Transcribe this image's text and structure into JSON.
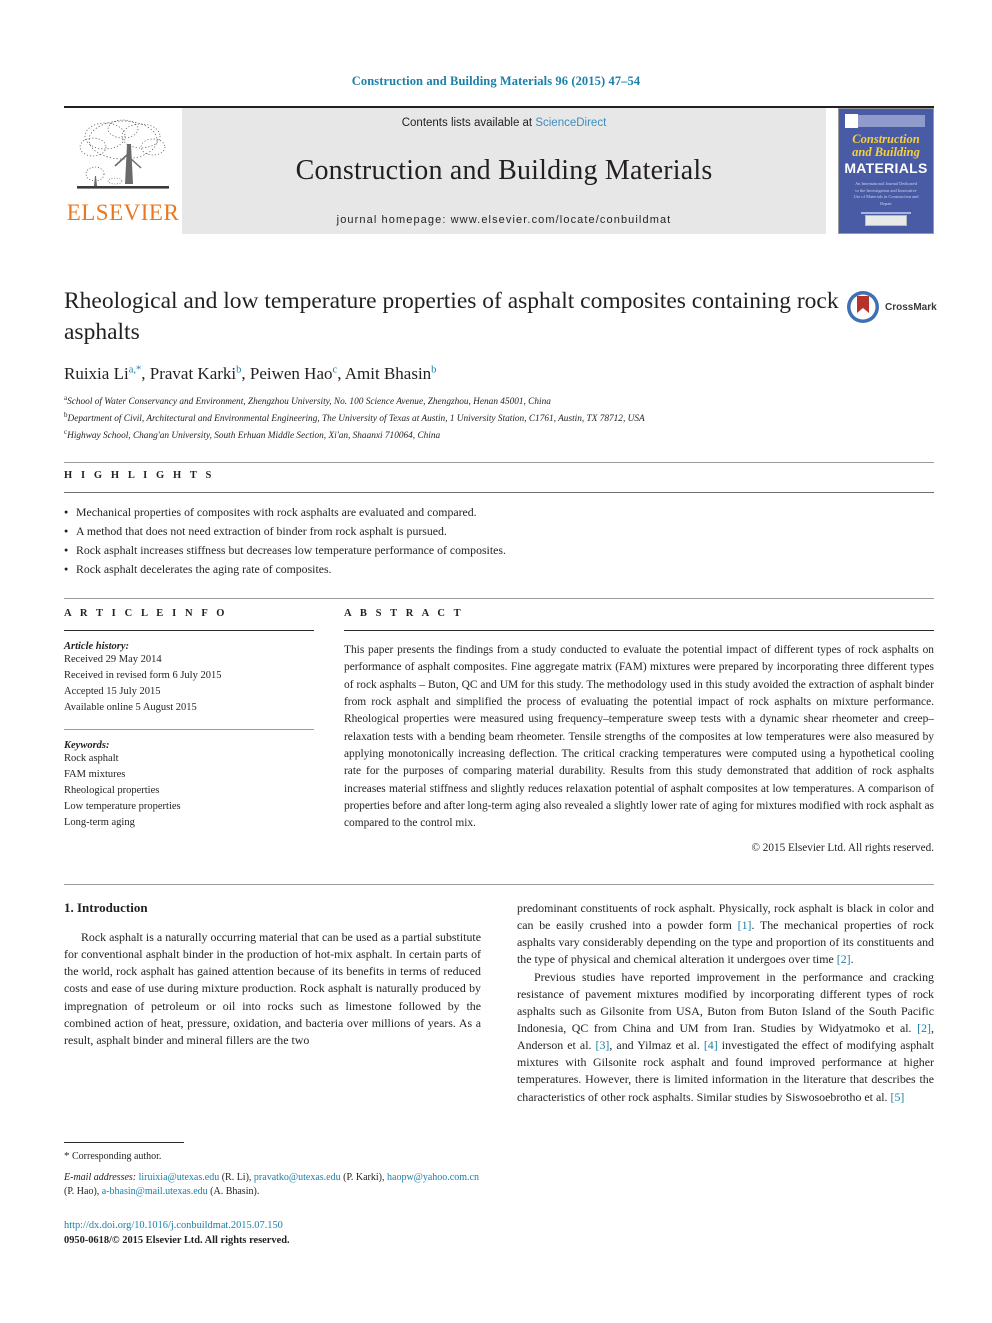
{
  "running_head": "Construction and Building Materials 96 (2015) 47–54",
  "masthead": {
    "publisher_name": "ELSEVIER",
    "contents_prefix": "Contents lists available at ",
    "contents_link": "ScienceDirect",
    "journal_name": "Construction and Building Materials",
    "homepage": "journal homepage: www.elsevier.com/locate/conbuildmat",
    "cover": {
      "line1": "Construction",
      "line2": "and Building",
      "line3": "MATERIALS",
      "blurb": "An International Journal Dedicated to the Investigation and Innovative Use of Materials in Construction and Repair"
    }
  },
  "crossmark": {
    "label": "CrossMark"
  },
  "article": {
    "title": "Rheological and low temperature properties of asphalt composites containing rock asphalts",
    "authors": [
      {
        "name": "Ruixia Li",
        "marks": "a,*"
      },
      {
        "name": "Pravat Karki",
        "marks": "b"
      },
      {
        "name": "Peiwen Hao",
        "marks": "c"
      },
      {
        "name": "Amit Bhasin",
        "marks": "b"
      }
    ],
    "affiliations": [
      {
        "mark": "a",
        "text": "School of Water Conservancy and Environment, Zhengzhou University, No. 100 Science Avenue, Zhengzhou, Henan 45001, China"
      },
      {
        "mark": "b",
        "text": "Department of Civil, Architectural and Environmental Engineering, The University of Texas at Austin, 1 University Station, C1761, Austin, TX 78712, USA"
      },
      {
        "mark": "c",
        "text": "Highway School, Chang'an University, South Erhuan Middle Section, Xi'an, Shaanxi 710064, China"
      }
    ]
  },
  "highlights": {
    "heading": "H I G H L I G H T S",
    "items": [
      "Mechanical properties of composites with rock asphalts are evaluated and compared.",
      "A method that does not need extraction of binder from rock asphalt is pursued.",
      "Rock asphalt increases stiffness but decreases low temperature performance of composites.",
      "Rock asphalt decelerates the aging rate of composites."
    ]
  },
  "article_info": {
    "heading": "A R T I C L E    I N F O",
    "history_label": "Article history:",
    "history": [
      "Received 29 May 2014",
      "Received in revised form 6 July 2015",
      "Accepted 15 July 2015",
      "Available online 5 August 2015"
    ],
    "keywords_label": "Keywords:",
    "keywords": [
      "Rock asphalt",
      "FAM mixtures",
      "Rheological properties",
      "Low temperature properties",
      "Long-term aging"
    ]
  },
  "abstract": {
    "heading": "A B S T R A C T",
    "text": "This paper presents the findings from a study conducted to evaluate the potential impact of different types of rock asphalts on performance of asphalt composites. Fine aggregate matrix (FAM) mixtures were prepared by incorporating three different types of rock asphalts – Buton, QC and UM for this study. The methodology used in this study avoided the extraction of asphalt binder from rock asphalt and simplified the process of evaluating the potential impact of rock asphalts on mixture performance. Rheological properties were measured using frequency–temperature sweep tests with a dynamic shear rheometer and creep–relaxation tests with a bending beam rheometer. Tensile strengths of the composites at low temperatures were also measured by applying monotonically increasing deflection. The critical cracking temperatures were computed using a hypothetical cooling rate for the purposes of comparing material durability. Results from this study demonstrated that addition of rock asphalts increases material stiffness and slightly reduces relaxation potential of asphalt composites at low temperatures. A comparison of properties before and after long-term aging also revealed a slightly lower rate of aging for mixtures modified with rock asphalt as compared to the control mix.",
    "copyright": "© 2015 Elsevier Ltd. All rights reserved."
  },
  "introduction": {
    "heading": "1. Introduction",
    "left_para1": "Rock asphalt is a naturally occurring material that can be used as a partial substitute for conventional asphalt binder in the production of hot-mix asphalt. In certain parts of the world, rock asphalt has gained attention because of its benefits in terms of reduced costs and ease of use during mixture production. Rock asphalt is naturally produced by impregnation of petroleum or oil into rocks such as limestone followed by the combined action of heat, pressure, oxidation, and bacteria over millions of years. As a result, asphalt binder and mineral fillers are the two",
    "right_para1_a": "predominant constituents of rock asphalt. Physically, rock asphalt is black in color and can be easily crushed into a powder form ",
    "right_para1_ref1": "[1]",
    "right_para1_b": ". The mechanical properties of rock asphalts vary considerably depending on the type and proportion of its constituents and the type of physical and chemical alteration it undergoes over time ",
    "right_para1_ref2": "[2]",
    "right_para1_c": ".",
    "right_para2_a": "Previous studies have reported improvement in the performance and cracking resistance of pavement mixtures modified by incorporating different types of rock asphalts such as Gilsonite from USA, Buton from Buton Island of the South Pacific Indonesia, QC from China and UM from Iran. Studies by Widyatmoko et al. ",
    "right_para2_ref2": "[2]",
    "right_para2_b": ", Anderson et al. ",
    "right_para2_ref3": "[3]",
    "right_para2_c": ", and Yilmaz et al. ",
    "right_para2_ref4": "[4]",
    "right_para2_d": " investigated the effect of modifying asphalt mixtures with Gilsonite rock asphalt and found improved performance at higher temperatures. However, there is limited information in the literature that describes the characteristics of other rock asphalts. Similar studies by Siswosoebrotho et al. ",
    "right_para2_ref5": "[5]"
  },
  "footnote": {
    "corresponding": "Corresponding author.",
    "email_label": "E-mail addresses:",
    "emails": [
      {
        "address": "liruixia@utexas.edu",
        "owner": "(R. Li)"
      },
      {
        "address": "pravatko@utexas.edu",
        "owner": "(P. Karki)"
      },
      {
        "address": "haopw@yahoo.com.cn",
        "owner": "(P. Hao)"
      },
      {
        "address": "a-bhasin@mail.utexas.edu",
        "owner": "(A. Bhasin)"
      }
    ]
  },
  "footer": {
    "doi": "http://dx.doi.org/10.1016/j.conbuildmat.2015.07.150",
    "issn": "0950-0618/© 2015 Elsevier Ltd. All rights reserved."
  },
  "colors": {
    "link": "#1b7fa8",
    "elsevier_orange": "#e87722",
    "band_gray": "#e7e7e7",
    "cover_blue": "#4a5ba6"
  }
}
